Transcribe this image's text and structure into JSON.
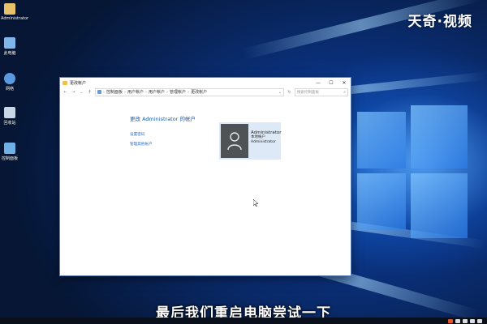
{
  "desktop": {
    "icons": [
      {
        "label": "Administrator",
        "icon": "user-folder-icon",
        "color": "#e8c26a"
      },
      {
        "label": "此电脑",
        "icon": "computer-icon",
        "color": "#7fb5ea"
      },
      {
        "label": "网络",
        "icon": "network-icon",
        "color": "#5a9be0"
      },
      {
        "label": "回收站",
        "icon": "recycle-bin-icon",
        "color": "#c9d6e6"
      },
      {
        "label": "控制面板",
        "icon": "control-panel-icon",
        "color": "#6fb1e6"
      }
    ]
  },
  "watermark": {
    "text": "天奇·视频"
  },
  "window": {
    "title": "更改帐户",
    "controls": {
      "minimize": "—",
      "maximize": "☐",
      "close": "✕"
    },
    "nav": {
      "back": "←",
      "forward": "→",
      "recent": "⌄",
      "up": "↑"
    },
    "breadcrumb": [
      "控制面板",
      "用户帐户",
      "用户帐户",
      "管理帐户",
      "更改帐户"
    ],
    "search_placeholder": "搜索控制面板",
    "heading": "更改 Administrator 的帐户",
    "links": [
      "设置密码",
      "管理其他帐户"
    ],
    "account": {
      "name": "Administrator",
      "type": "本地帐户",
      "group": "Administrator"
    }
  },
  "subtitle": "最后我们重启电脑尝试一下",
  "colors": {
    "link": "#1c6fcf",
    "heading": "#1e5aa8",
    "card_bg": "#dde9f7"
  }
}
